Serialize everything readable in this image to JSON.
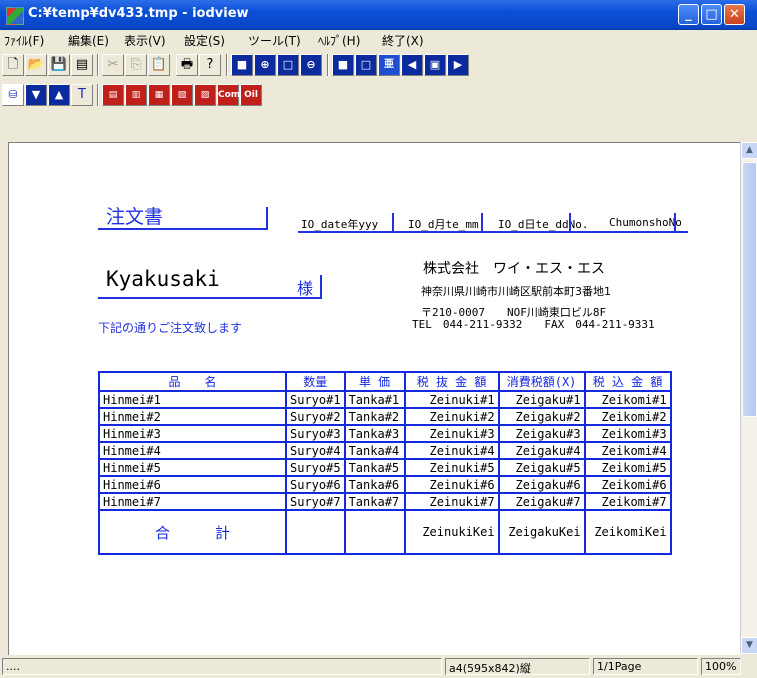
{
  "window": {
    "title": "C:¥temp¥dv433.tmp - iodview"
  },
  "menu": [
    "ﾌｧｲﾙ(F)",
    "編集(E)",
    "表示(V)",
    "設定(S)",
    "ツール(T)",
    "ﾍﾙﾌﾟ(H)",
    "終了(X)"
  ],
  "toolbar": {
    "red_labels": [
      "Com",
      "Oil"
    ]
  },
  "doc": {
    "title": "注文書",
    "date_fields": [
      "IO_date年yyy",
      "IO_d月te_mm",
      "IO_d日te_ddNo.",
      "ChumonshoNo"
    ],
    "customer": "Kyakusaki",
    "honorific": "様",
    "note": "下記の通りご注文致します",
    "company": "株式会社　ワイ・エス・エス",
    "address": "神奈川県川崎市川崎区駅前本町3番地1",
    "postal": "〒210-0007　　NOF川崎東口ビル8F",
    "phone": "TEL　044-211-9332　　FAX　044-211-9331"
  },
  "table": {
    "headers": [
      "品　　名",
      "数量",
      "単 価",
      "税 抜 金 額",
      "消費税額(X)",
      "税 込 金 額"
    ],
    "rows": [
      [
        "Hinmei#1",
        "Suryo#1",
        "Tanka#1",
        "Zeinuki#1",
        "Zeigaku#1",
        "Zeikomi#1"
      ],
      [
        "Hinmei#2",
        "Suryo#2",
        "Tanka#2",
        "Zeinuki#2",
        "Zeigaku#2",
        "Zeikomi#2"
      ],
      [
        "Hinmei#3",
        "Suryo#3",
        "Tanka#3",
        "Zeinuki#3",
        "Zeigaku#3",
        "Zeikomi#3"
      ],
      [
        "Hinmei#4",
        "Suryo#4",
        "Tanka#4",
        "Zeinuki#4",
        "Zeigaku#4",
        "Zeikomi#4"
      ],
      [
        "Hinmei#5",
        "Suryo#5",
        "Tanka#5",
        "Zeinuki#5",
        "Zeigaku#5",
        "Zeikomi#5"
      ],
      [
        "Hinmei#6",
        "Suryo#6",
        "Tanka#6",
        "Zeinuki#6",
        "Zeigaku#6",
        "Zeikomi#6"
      ],
      [
        "Hinmei#7",
        "Suryo#7",
        "Tanka#7",
        "Zeinuki#7",
        "Zeigaku#7",
        "Zeikomi#7"
      ]
    ],
    "total_label": "合　　　計",
    "totals": [
      "",
      "",
      "ZeinukiKei",
      "ZeigakuKei",
      "ZeikomiKei"
    ]
  },
  "status": {
    "left": "....",
    "paper": "a4(595x842)縦",
    "page": "1/1Page",
    "zoom": "100%"
  },
  "colors": {
    "accent": "#1428E0",
    "titlebar": "#0A4FD6"
  }
}
